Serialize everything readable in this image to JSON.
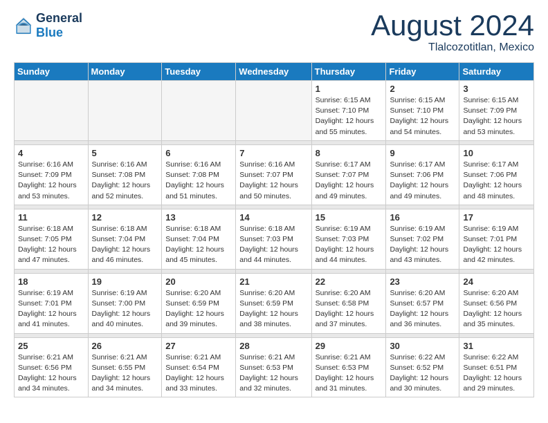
{
  "header": {
    "logo_general": "General",
    "logo_blue": "Blue",
    "month_title": "August 2024",
    "location": "Tlalcozotitlan, Mexico"
  },
  "days_of_week": [
    "Sunday",
    "Monday",
    "Tuesday",
    "Wednesday",
    "Thursday",
    "Friday",
    "Saturday"
  ],
  "weeks": [
    {
      "days": [
        {
          "num": "",
          "empty": true
        },
        {
          "num": "",
          "empty": true
        },
        {
          "num": "",
          "empty": true
        },
        {
          "num": "",
          "empty": true
        },
        {
          "num": "1",
          "sunrise": "6:15 AM",
          "sunset": "7:10 PM",
          "daylight": "12 hours and 55 minutes."
        },
        {
          "num": "2",
          "sunrise": "6:15 AM",
          "sunset": "7:10 PM",
          "daylight": "12 hours and 54 minutes."
        },
        {
          "num": "3",
          "sunrise": "6:15 AM",
          "sunset": "7:09 PM",
          "daylight": "12 hours and 53 minutes."
        }
      ]
    },
    {
      "days": [
        {
          "num": "4",
          "sunrise": "6:16 AM",
          "sunset": "7:09 PM",
          "daylight": "12 hours and 53 minutes."
        },
        {
          "num": "5",
          "sunrise": "6:16 AM",
          "sunset": "7:08 PM",
          "daylight": "12 hours and 52 minutes."
        },
        {
          "num": "6",
          "sunrise": "6:16 AM",
          "sunset": "7:08 PM",
          "daylight": "12 hours and 51 minutes."
        },
        {
          "num": "7",
          "sunrise": "6:16 AM",
          "sunset": "7:07 PM",
          "daylight": "12 hours and 50 minutes."
        },
        {
          "num": "8",
          "sunrise": "6:17 AM",
          "sunset": "7:07 PM",
          "daylight": "12 hours and 49 minutes."
        },
        {
          "num": "9",
          "sunrise": "6:17 AM",
          "sunset": "7:06 PM",
          "daylight": "12 hours and 49 minutes."
        },
        {
          "num": "10",
          "sunrise": "6:17 AM",
          "sunset": "7:06 PM",
          "daylight": "12 hours and 48 minutes."
        }
      ]
    },
    {
      "days": [
        {
          "num": "11",
          "sunrise": "6:18 AM",
          "sunset": "7:05 PM",
          "daylight": "12 hours and 47 minutes."
        },
        {
          "num": "12",
          "sunrise": "6:18 AM",
          "sunset": "7:04 PM",
          "daylight": "12 hours and 46 minutes."
        },
        {
          "num": "13",
          "sunrise": "6:18 AM",
          "sunset": "7:04 PM",
          "daylight": "12 hours and 45 minutes."
        },
        {
          "num": "14",
          "sunrise": "6:18 AM",
          "sunset": "7:03 PM",
          "daylight": "12 hours and 44 minutes."
        },
        {
          "num": "15",
          "sunrise": "6:19 AM",
          "sunset": "7:03 PM",
          "daylight": "12 hours and 44 minutes."
        },
        {
          "num": "16",
          "sunrise": "6:19 AM",
          "sunset": "7:02 PM",
          "daylight": "12 hours and 43 minutes."
        },
        {
          "num": "17",
          "sunrise": "6:19 AM",
          "sunset": "7:01 PM",
          "daylight": "12 hours and 42 minutes."
        }
      ]
    },
    {
      "days": [
        {
          "num": "18",
          "sunrise": "6:19 AM",
          "sunset": "7:01 PM",
          "daylight": "12 hours and 41 minutes."
        },
        {
          "num": "19",
          "sunrise": "6:19 AM",
          "sunset": "7:00 PM",
          "daylight": "12 hours and 40 minutes."
        },
        {
          "num": "20",
          "sunrise": "6:20 AM",
          "sunset": "6:59 PM",
          "daylight": "12 hours and 39 minutes."
        },
        {
          "num": "21",
          "sunrise": "6:20 AM",
          "sunset": "6:59 PM",
          "daylight": "12 hours and 38 minutes."
        },
        {
          "num": "22",
          "sunrise": "6:20 AM",
          "sunset": "6:58 PM",
          "daylight": "12 hours and 37 minutes."
        },
        {
          "num": "23",
          "sunrise": "6:20 AM",
          "sunset": "6:57 PM",
          "daylight": "12 hours and 36 minutes."
        },
        {
          "num": "24",
          "sunrise": "6:20 AM",
          "sunset": "6:56 PM",
          "daylight": "12 hours and 35 minutes."
        }
      ]
    },
    {
      "days": [
        {
          "num": "25",
          "sunrise": "6:21 AM",
          "sunset": "6:56 PM",
          "daylight": "12 hours and 34 minutes."
        },
        {
          "num": "26",
          "sunrise": "6:21 AM",
          "sunset": "6:55 PM",
          "daylight": "12 hours and 34 minutes."
        },
        {
          "num": "27",
          "sunrise": "6:21 AM",
          "sunset": "6:54 PM",
          "daylight": "12 hours and 33 minutes."
        },
        {
          "num": "28",
          "sunrise": "6:21 AM",
          "sunset": "6:53 PM",
          "daylight": "12 hours and 32 minutes."
        },
        {
          "num": "29",
          "sunrise": "6:21 AM",
          "sunset": "6:53 PM",
          "daylight": "12 hours and 31 minutes."
        },
        {
          "num": "30",
          "sunrise": "6:22 AM",
          "sunset": "6:52 PM",
          "daylight": "12 hours and 30 minutes."
        },
        {
          "num": "31",
          "sunrise": "6:22 AM",
          "sunset": "6:51 PM",
          "daylight": "12 hours and 29 minutes."
        }
      ]
    }
  ],
  "labels": {
    "sunrise": "Sunrise:",
    "sunset": "Sunset:",
    "daylight": "Daylight:"
  }
}
